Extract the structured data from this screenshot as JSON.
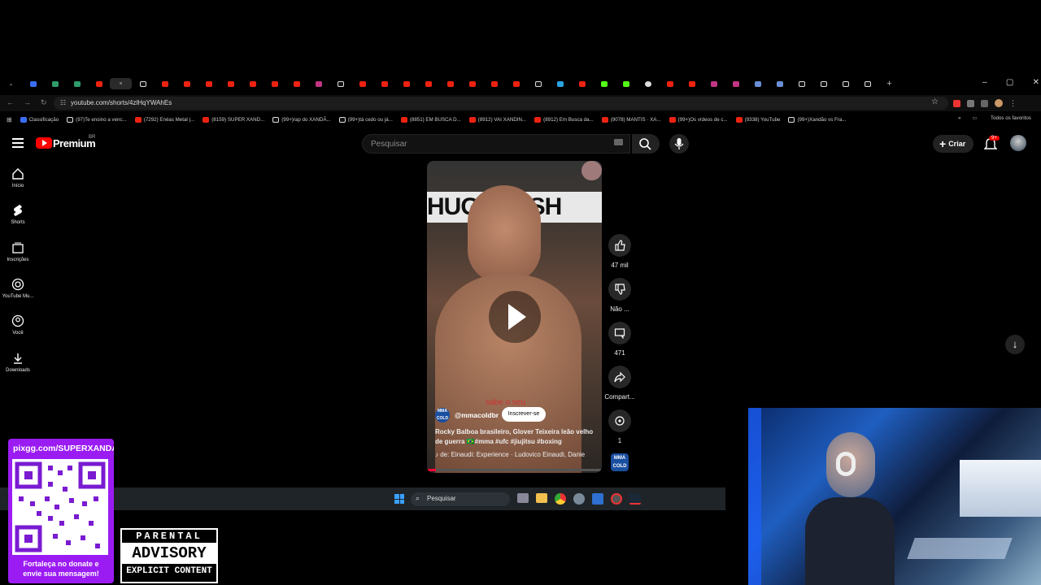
{
  "browser": {
    "tabs": [
      "",
      "",
      "",
      "",
      "",
      "",
      "",
      "",
      "",
      "",
      "",
      "",
      "",
      "",
      "",
      "",
      "",
      "",
      "",
      "",
      "",
      "",
      "",
      "",
      "",
      "",
      "",
      "",
      "",
      "",
      "",
      "",
      "",
      "",
      "",
      "",
      "",
      "",
      "",
      "",
      "",
      "",
      "",
      "",
      ""
    ],
    "url": "youtube.com/shorts/4zlHqYWAhEs",
    "bookmarks": [
      "Classificação",
      "(97)Te ensino a venc...",
      "(7292) Enéas Metal |...",
      "(8159) SUPER XAND...",
      "(99+)rap do XANDÃ...",
      "(99+)tá cedo ou já...",
      "(8851) EM BUSCA D...",
      "(8912) VAI XANDIN...",
      "(8912) Em Busca da...",
      "(9078) MANTIS · XA...",
      "(99+)Os vídeos de c...",
      "(9338) YouTube",
      "(99+)Xandão vs Fra..."
    ],
    "all_favorites": "Todos os favoritos"
  },
  "youtube": {
    "logo": "Premium",
    "country": "BR",
    "search_placeholder": "Pesquisar",
    "create_label": "Criar",
    "notif_badge": "9+",
    "sidebar": [
      {
        "label": "Início",
        "icon": "home-icon"
      },
      {
        "label": "Shorts",
        "icon": "shorts-icon"
      },
      {
        "label": "Inscrições",
        "icon": "subscriptions-icon"
      },
      {
        "label": "YouTube Mu...",
        "icon": "youtube-music-icon"
      },
      {
        "label": "Você",
        "icon": "you-icon"
      },
      {
        "label": "Downloads",
        "icon": "downloads-icon"
      }
    ],
    "short": {
      "banner_text": "HUGHANSH",
      "caption_overlay": "sabe o seu",
      "channel": "@mmacoldbr",
      "subscribe": "Inscrever-se",
      "title": "Rocky Balboa brasileiro, Glover Teixeira leão velho de guerra 🇧🇷#mma #ufc #jiujitsu #boxing",
      "music": "de: Einaudi: Experience · Ludovico Einaudi, Danie",
      "channel_avatar": "MMA COLD"
    },
    "actions": [
      {
        "label": "47 mil",
        "icon": "like-icon"
      },
      {
        "label": "Não ...",
        "icon": "dislike-icon"
      },
      {
        "label": "471",
        "icon": "comment-icon"
      },
      {
        "label": "Compart...",
        "icon": "share-icon"
      },
      {
        "label": "1",
        "icon": "remix-icon"
      }
    ]
  },
  "taskbar": {
    "search": "Pesquisar"
  },
  "overlay": {
    "pix_url": "pixgg.com/SUPERXANDA",
    "pix_message": "Fortaleça no donate e envie sua mensagem!",
    "advisory": [
      "PARENTAL",
      "ADVISORY",
      "EXPLICIT CONTENT"
    ]
  },
  "colors": {
    "accent": "#ff0033",
    "pix": "#9b1cf2"
  }
}
